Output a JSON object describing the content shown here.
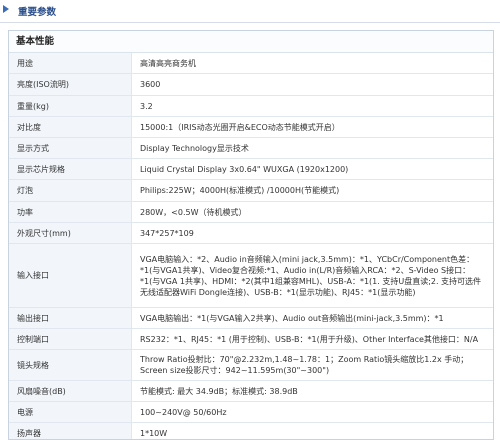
{
  "header": {
    "title": "重要参数"
  },
  "section": {
    "title": "基本性能"
  },
  "rows": [
    {
      "label": "用途",
      "value": "高清高亮商务机"
    },
    {
      "label": "亮度(ISO流明)",
      "value": "3600"
    },
    {
      "label": "重量(kg)",
      "value": "3.2"
    },
    {
      "label": "对比度",
      "value": "15000:1（IRIS动态光圈开启&ECO动态节能模式开启）"
    },
    {
      "label": "显示方式",
      "value": "Display Technology显示技术"
    },
    {
      "label": "显示芯片规格",
      "value": "Liquid Crystal Display 3x0.64\" WUXGA (1920x1200)"
    },
    {
      "label": "灯泡",
      "value": "Philips:225W；4000H(标准模式) /10000H(节能模式)"
    },
    {
      "label": "功率",
      "value": "280W，<0.5W（待机模式）"
    },
    {
      "label": "外观尺寸(mm)",
      "value": "347*257*109"
    },
    {
      "label": "输入接口",
      "value": "VGA电脑输入：*2、Audio in音频输入(mini jack,3.5mm)：*1、YCbCr/Component色差：\n*1(与VGA1共享)、Video复合视频:*1、Audio in(L/R)音频输入RCA：*2、S-Video S接口：\n*1(与VGA 1共享)、HDMI：*2(其中1组兼容MHL)、USB-A：*1(1. 支持U盘直读;2. 支持可选件\n无线适配器WiFi Dongle连接)、USB-B：*1(显示功能)、RJ45：*1(显示功能)"
    },
    {
      "label": "输出接口",
      "value": "VGA电脑输出：*1(与VGA输入2共享)、Audio out音频输出(mini-jack,3.5mm)：*1"
    },
    {
      "label": "控制端口",
      "value": "RS232：*1、RJ45：*1 (用于控制)、USB-B：*1(用于升级)、Other Interface其他接口：N/A"
    },
    {
      "label": "镜头规格",
      "value": "Throw Ratio投射比：70\"@2.232m,1.48~1.78：1；Zoom Ratio镜头缩放比1.2x 手动；\nScreen size投影尺寸：942~11.595m(30\"~300\")"
    },
    {
      "label": "风扇噪音(dB)",
      "value": "节能模式: 最大 34.9dB；标准模式: 38.9dB"
    },
    {
      "label": "电源",
      "value": "100~240V@ 50/60Hz"
    },
    {
      "label": "扬声器",
      "value": "1*10W"
    }
  ]
}
